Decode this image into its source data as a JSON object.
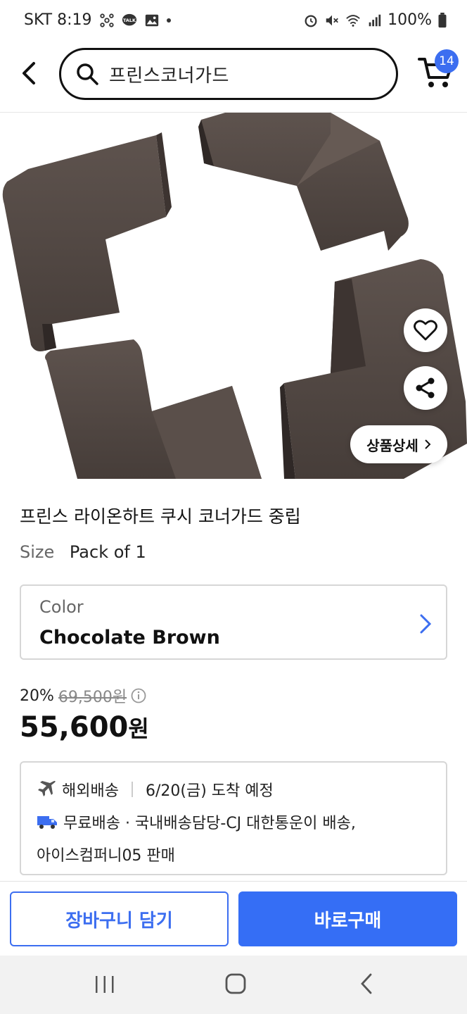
{
  "status_bar": {
    "carrier_time": "SKT 8:19",
    "battery": "100%",
    "talk_badge": "TALK"
  },
  "header": {
    "search_value": "프린스코너가드",
    "cart_count": "14",
    "accent": "#3c6ef0"
  },
  "hero": {
    "detail_button": "상품상세"
  },
  "product": {
    "title": "프린스 라이온하트 쿠시 코너가드 중립",
    "size_label": "Size",
    "size_value": "Pack of 1",
    "color_label": "Color",
    "color_value": "Chocolate Brown",
    "discount": "20%",
    "original_price": "69,500원",
    "price_number": "55,600",
    "price_unit": "원"
  },
  "shipping": {
    "overseas": "해외배송",
    "arrival": "6/20(금) 도착 예정",
    "free_delivery": "무료배송 · 국내배송담당-CJ 대한통운이 배송,",
    "seller": "아이스컴퍼니05 판매"
  },
  "actions": {
    "add_to_cart": "장바구니 담기",
    "buy_now": "바로구매"
  }
}
